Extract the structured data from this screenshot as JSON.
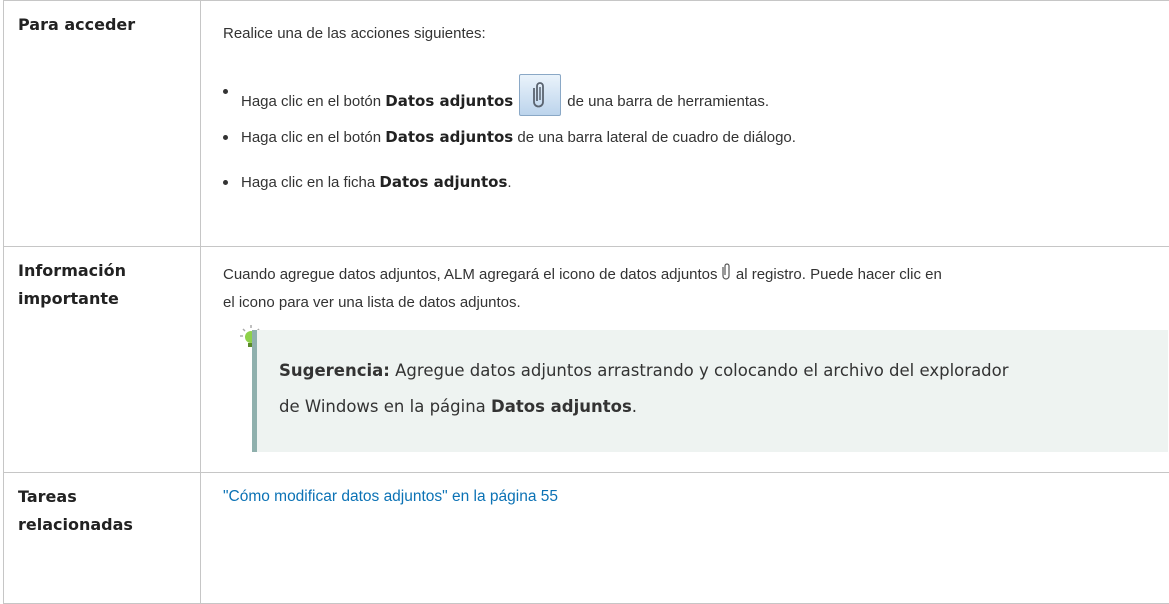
{
  "rows": {
    "access": {
      "label": "Para acceder",
      "intro": "Realice una de las acciones siguientes:",
      "bullets": [
        {
          "pre": "Haga clic en el botón ",
          "bold": "Datos adjuntos",
          "post": "de una barra de herramientas.",
          "icon": "paperclip-button-icon"
        },
        {
          "pre": "Haga clic en el botón ",
          "bold": "Datos adjuntos",
          "post": " de una barra lateral de cuadro de diálogo."
        },
        {
          "pre": "Haga clic en la ficha ",
          "bold": "Datos adjuntos",
          "post": "."
        }
      ]
    },
    "important": {
      "label_line1": "Información",
      "label_line2": "importante",
      "text_part1": "Cuando agregue datos adjuntos, ALM agregará el icono de datos adjuntos ",
      "text_part2": " al registro. Puede hacer clic en",
      "text_line2": "el icono para ver una lista de datos adjuntos.",
      "tip": {
        "icon": "lightbulb-icon",
        "label": "Sugerencia:",
        "text1": " Agregue datos adjuntos arrastrando y colocando el archivo del explorador",
        "text2": "de Windows en la página ",
        "bold": "Datos adjuntos",
        "end": "."
      }
    },
    "related": {
      "label_line1": "Tareas",
      "label_line2": "relacionadas",
      "link": "\"Cómo modificar datos adjuntos\" en la página 55"
    }
  },
  "colors": {
    "border": "#c6c6c6",
    "link": "#0b72b5",
    "tip_background": "#eef3f1",
    "tip_bar": "#8fb0ad"
  }
}
